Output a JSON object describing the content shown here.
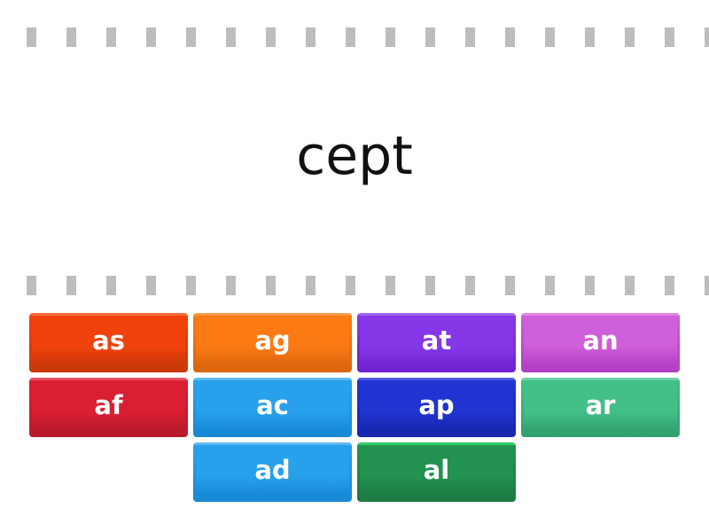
{
  "prompt": {
    "text": "cept"
  },
  "divider_dash_count": 18,
  "tiles": [
    {
      "label": "as",
      "color": "#f2420c",
      "top": "#f96a3c",
      "bottom": "#c8380a"
    },
    {
      "label": "ag",
      "color": "#fc7a14",
      "top": "#fd9a48",
      "bottom": "#d9650c"
    },
    {
      "label": "at",
      "color": "#8637e8",
      "top": "#a064f2",
      "bottom": "#6f24cf"
    },
    {
      "label": "an",
      "color": "#cf5ed9",
      "top": "#dd86e4",
      "bottom": "#b43ec4"
    },
    {
      "label": "af",
      "color": "#db1f33",
      "top": "#e65062",
      "bottom": "#b81a2c"
    },
    {
      "label": "ac",
      "color": "#28a1ec",
      "top": "#5bb8f2",
      "bottom": "#1688d4"
    },
    {
      "label": "ap",
      "color": "#2034d2",
      "top": "#4a5ae0",
      "bottom": "#1726ae"
    },
    {
      "label": "ar",
      "color": "#43c087",
      "top": "#6dd0a2",
      "bottom": "#32a06f"
    },
    {
      "label": "ad",
      "color": "#28a1ec",
      "top": "#5bb8f2",
      "bottom": "#1688d4"
    },
    {
      "label": "al",
      "color": "#239250",
      "top": "#2fcc64",
      "bottom": "#1c7a42"
    }
  ]
}
